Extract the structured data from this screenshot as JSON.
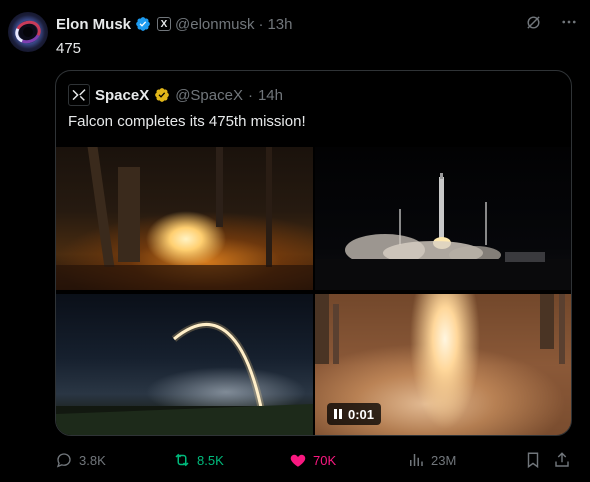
{
  "post": {
    "author_name": "Elon Musk",
    "author_handle": "@elonmusk",
    "separator": "·",
    "time": "13h",
    "affiliate_badge": "X",
    "text": "475"
  },
  "quote": {
    "author_name": "SpaceX",
    "author_handle": "@SpaceX",
    "separator": "·",
    "time": "14h",
    "text": "Falcon completes its 475th mission!",
    "video_time": "0:01"
  },
  "actions": {
    "replies": "3.8K",
    "reposts": "8.5K",
    "likes": "70K",
    "views": "23M"
  },
  "colors": {
    "verified_blue": "#1d9bf0",
    "verified_gold": "#e2b719",
    "repost_green": "#00ba7c",
    "like_pink": "#f91880",
    "muted": "#71767b"
  }
}
